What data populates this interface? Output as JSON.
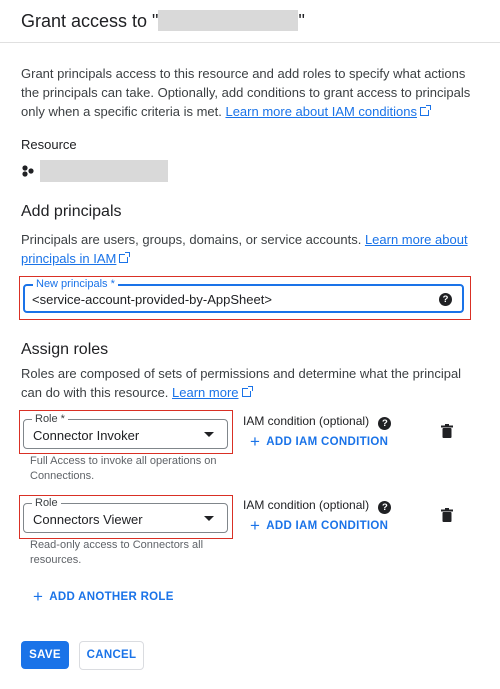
{
  "header": {
    "title_prefix": "Grant access to \"",
    "title_suffix": "\""
  },
  "intro": {
    "text": "Grant principals access to this resource and add roles to specify what actions the principals can take. Optionally, add conditions to grant access to principals only when a specific criteria is met. ",
    "link": "Learn more about IAM conditions"
  },
  "resource": {
    "label": "Resource"
  },
  "principals": {
    "heading": "Add principals",
    "description": "Principals are users, groups, domains, or service accounts. ",
    "link": "Learn more about principals in IAM",
    "field_label": "New principals *",
    "field_value": "<service-account-provided-by-AppSheet>"
  },
  "roles": {
    "heading": "Assign roles",
    "description": "Roles are composed of sets of permissions and determine what the principal can do with this resource. ",
    "link": "Learn more",
    "items": [
      {
        "field_label": "Role *",
        "value": "Connector Invoker",
        "helper": "Full Access to invoke all operations on Connections.",
        "condition_label": "IAM condition (optional)",
        "add_condition": "ADD IAM CONDITION"
      },
      {
        "field_label": "Role",
        "value": "Connectors Viewer",
        "helper": "Read-only access to Connectors all resources.",
        "condition_label": "IAM condition (optional)",
        "add_condition": "ADD IAM CONDITION"
      }
    ],
    "add_another": "ADD ANOTHER ROLE"
  },
  "actions": {
    "save": "SAVE",
    "cancel": "CANCEL"
  },
  "colors": {
    "primary": "#1a73e8",
    "highlight": "#d93025"
  }
}
